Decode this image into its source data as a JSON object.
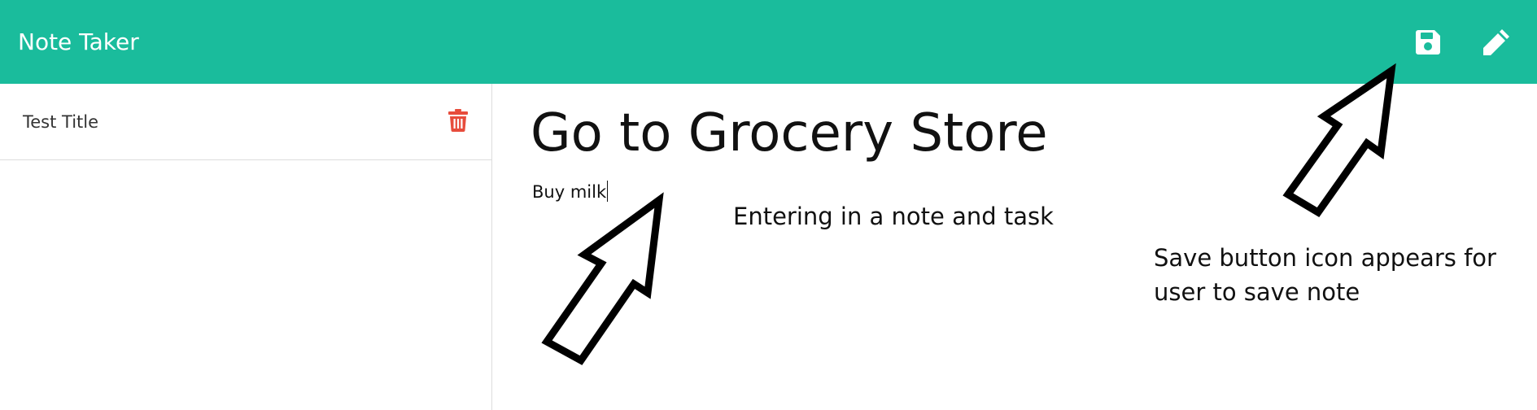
{
  "app": {
    "title": "Note Taker"
  },
  "header": {
    "save_icon": "save-icon",
    "edit_icon": "pencil-icon",
    "background_color": "#1abc9c"
  },
  "sidebar": {
    "notes": [
      {
        "title": "Test Title",
        "delete_icon": "trash-icon"
      }
    ]
  },
  "editor": {
    "title_value": "Go to Grocery Store",
    "text_value": "Buy milk"
  },
  "annotations": {
    "note_entry": "Entering in a note and task",
    "save_hint": "Save button icon appears for user to save note"
  },
  "colors": {
    "accent": "#1abc9c",
    "delete": "#e74c3c"
  }
}
